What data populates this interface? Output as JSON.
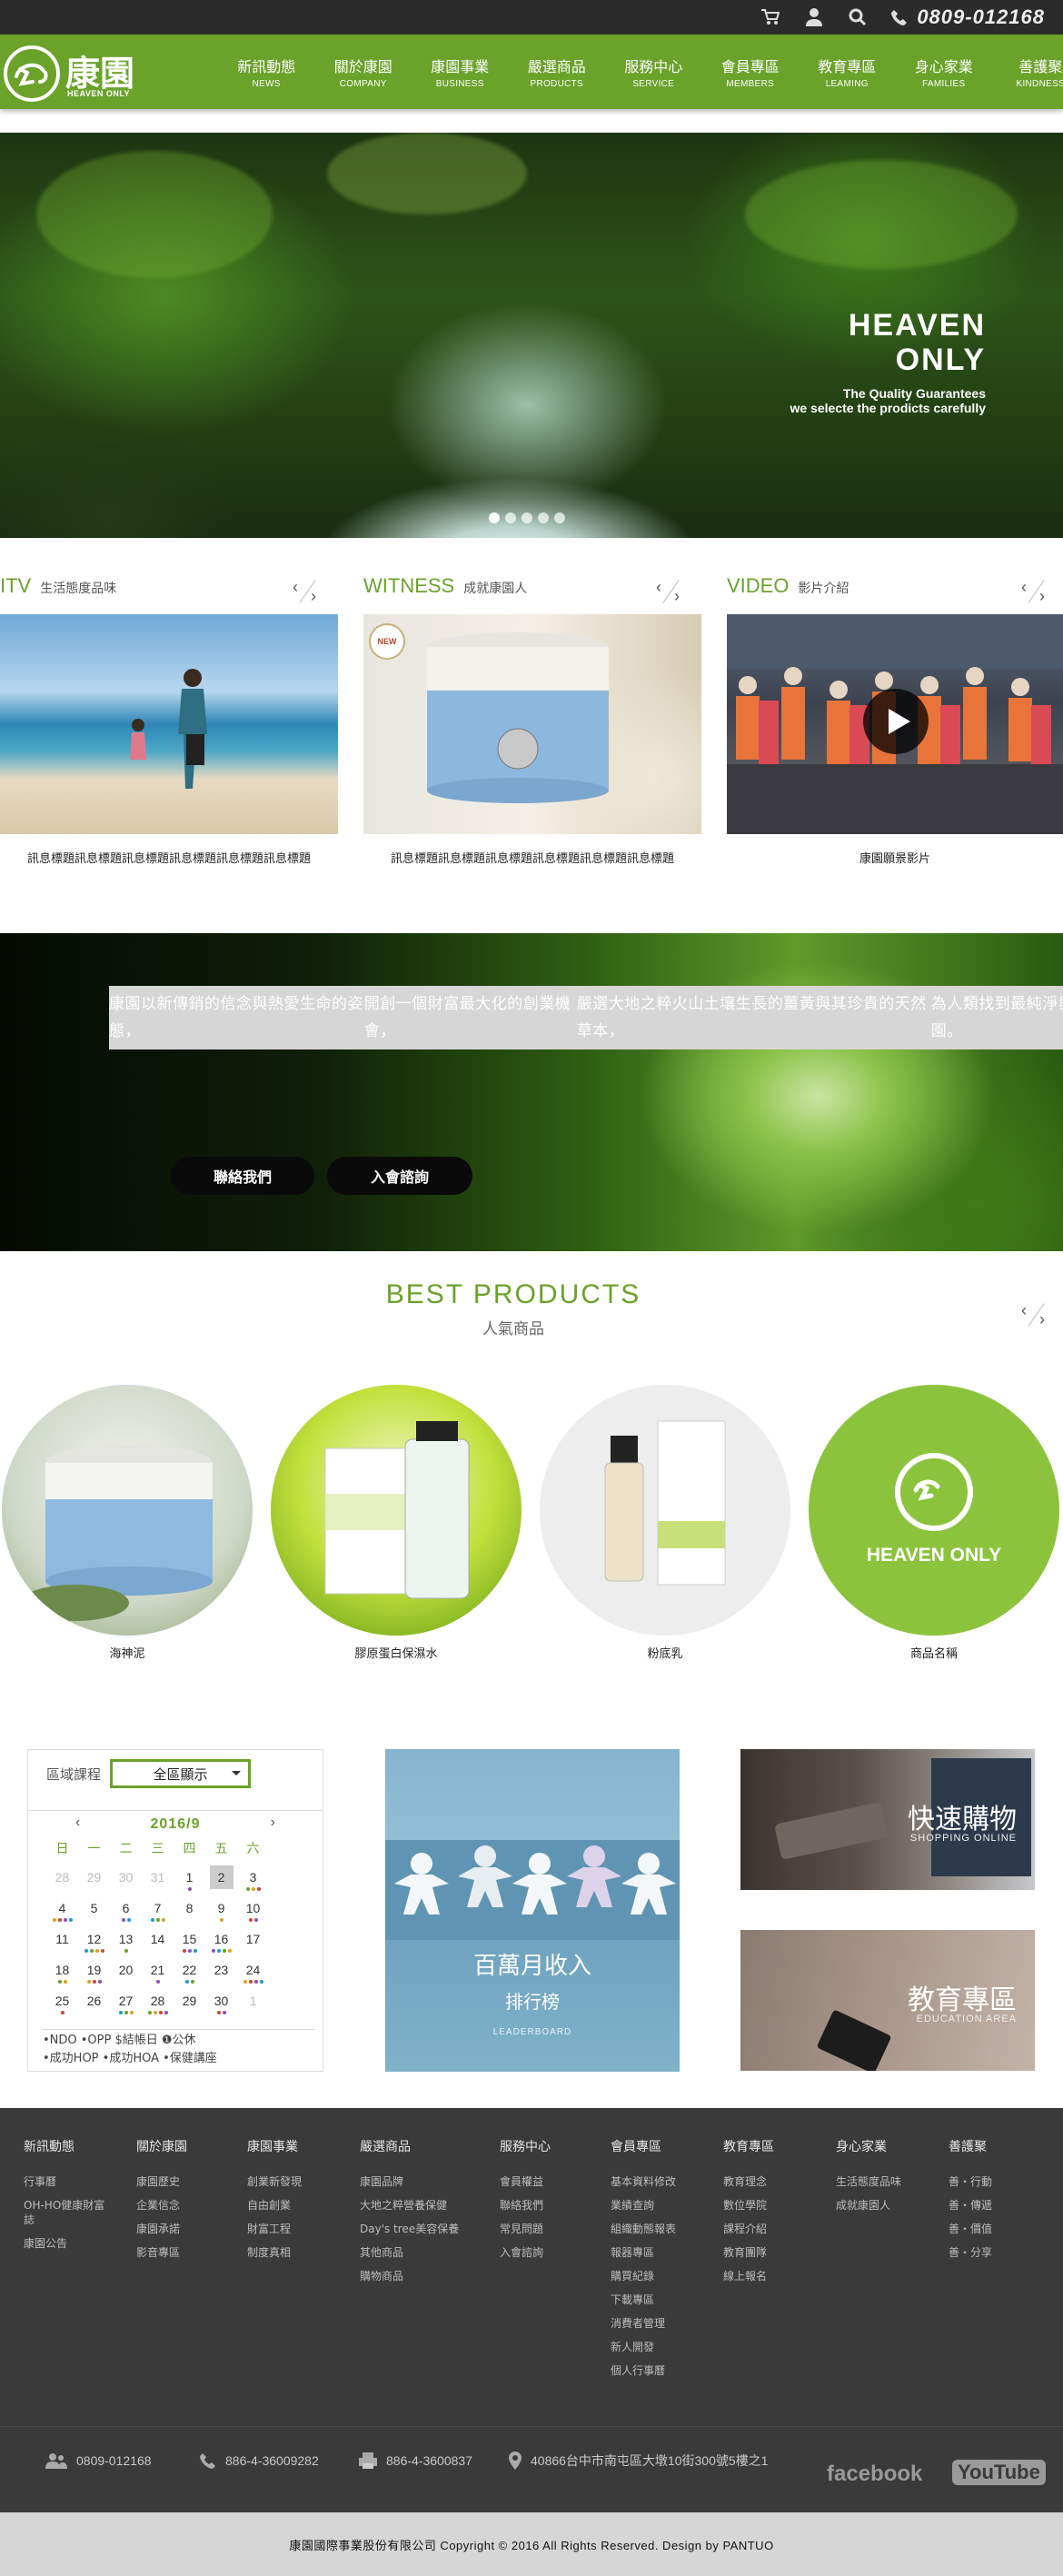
{
  "topbar": {
    "phone": "0809-012168",
    "icons": [
      "cart-icon",
      "user-icon",
      "search-icon",
      "phone-icon"
    ]
  },
  "logo": {
    "zh": "康園",
    "en": "HEAVEN ONLY"
  },
  "menu": [
    {
      "zh": "新訊動態",
      "en": "NEWS"
    },
    {
      "zh": "關於康園",
      "en": "COMPANY"
    },
    {
      "zh": "康園事業",
      "en": "BUSINESS"
    },
    {
      "zh": "嚴選商品",
      "en": "PRODUCTS"
    },
    {
      "zh": "服務中心",
      "en": "SERVICE"
    },
    {
      "zh": "會員專區",
      "en": "MEMBERS"
    },
    {
      "zh": "教育專區",
      "en": "LEAMING"
    },
    {
      "zh": "身心家業",
      "en": "FAMILIES"
    },
    {
      "zh": "善護聚",
      "en": "KINDNESS"
    }
  ],
  "hero": {
    "title_1": "HEAVEN",
    "title_2": "ONLY",
    "line_1": "The Quality Guarantees",
    "line_2": "we selecte the prodicts carefully",
    "slides": 5,
    "active_slide": 1
  },
  "sections": [
    {
      "en": "ITV",
      "zh": "生活態度品味",
      "caption": "訊息標題訊息標題訊息標題訊息標題訊息標題訊息標題"
    },
    {
      "en": "WITNESS",
      "zh": "成就康園人",
      "caption": "訊息標題訊息標題訊息標題訊息標題訊息標題訊息標題",
      "badge": "NEW"
    },
    {
      "en": "VIDEO",
      "zh": "影片介紹",
      "caption": "康園願景影片"
    }
  ],
  "banner": {
    "lines": [
      "康園以新傳銷的信念與熱愛生命的姿態，",
      "開創一個財富最大化的創業機會，",
      "嚴選大地之粹火山土壤生長的薑黃與其珍貴的天然草本，",
      "為人類找到最純淨與幸福的健康家園。"
    ],
    "btn_contact": "聯絡我們",
    "btn_join": "入會諮詢"
  },
  "best": {
    "title": "BEST  PRODUCTS",
    "sub": "人氣商品",
    "items": [
      {
        "name": "海神泥"
      },
      {
        "name": "膠原蛋白保濕水"
      },
      {
        "name": "粉底乳"
      },
      {
        "name": "商品名稱",
        "logo_text": "HEAVEN ONLY"
      }
    ]
  },
  "calendar": {
    "filter_label": "區域課程",
    "filter_value": "全區顯示",
    "month": "2016/9",
    "weekdays": [
      "日",
      "一",
      "二",
      "三",
      "四",
      "五",
      "六"
    ],
    "days": [
      "28",
      "29",
      "30",
      "31",
      "1",
      "2",
      "3",
      "4",
      "5",
      "6",
      "7",
      "8",
      "9",
      "10",
      "11",
      "12",
      "13",
      "14",
      "15",
      "16",
      "17",
      "18",
      "19",
      "20",
      "21",
      "22",
      "23",
      "24",
      "25",
      "26",
      "27",
      "28",
      "29",
      "30",
      "1"
    ],
    "legend_1": "•NDO  •OPP  $結帳日  ❶公休",
    "legend_2": "•成功HOP  •成功HOA  •保健講座"
  },
  "income": {
    "t1": "百萬月收入",
    "t2": "排行榜",
    "t3": "LEADERBOARD"
  },
  "shop": {
    "t1": "快速購物",
    "t2": "SHOPPING ONLINE"
  },
  "edu": {
    "t1": "教育專區",
    "t2": "EDUCATION AREA"
  },
  "footer": {
    "cols": [
      {
        "h": "新訊動態",
        "items": [
          "行事曆",
          "OH-HO健康財富誌",
          "康園公告"
        ]
      },
      {
        "h": "關於康園",
        "items": [
          "康園歷史",
          "企業信念",
          "康園承諾",
          "影音專區"
        ]
      },
      {
        "h": "康園事業",
        "items": [
          "創業新發現",
          "自由創業",
          "財富工程",
          "制度真相"
        ]
      },
      {
        "h": "嚴選商品",
        "items": [
          "康園品牌",
          "大地之粹營養保健",
          "Day's tree美容保養",
          "其他商品",
          "購物商品"
        ]
      },
      {
        "h": "服務中心",
        "items": [
          "會員權益",
          "聯絡我們",
          "常見問題",
          "入會諮詢"
        ]
      },
      {
        "h": "會員專區",
        "items": [
          "基本資料修改",
          "業績查詢",
          "組織動態報表",
          "報器專區",
          "購買紀錄",
          "下載專區",
          "消費者管理",
          "新人開發",
          "個人行事曆"
        ]
      },
      {
        "h": "教育專區",
        "items": [
          "教育理念",
          "數位學院",
          "課程介紹",
          "教育團隊",
          "線上報名"
        ]
      },
      {
        "h": "身心家業",
        "items": [
          "生活態度品味",
          "成就康園人"
        ]
      },
      {
        "h": "善護聚",
        "items": [
          "善・行動",
          "善・傳遞",
          "善・價值",
          "善・分享"
        ]
      }
    ],
    "contact": {
      "phone": "0809-012168",
      "tel": "886-4-36009282",
      "fax": "886-4-3600837",
      "address": "40866台中市南屯區大墩10街300號5樓之1"
    },
    "sns": {
      "facebook": "facebook",
      "youtube": "YouTube"
    },
    "copyright": "康園國際事業股份有限公司  Copyright © 2016 All Rights Reserved.    Design by PANTUO"
  }
}
